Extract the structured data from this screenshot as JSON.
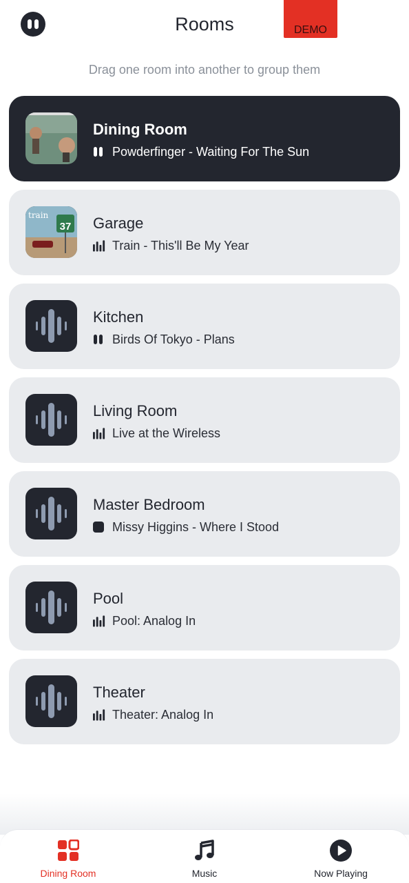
{
  "header": {
    "title": "Rooms",
    "demo_label": "DEMO"
  },
  "hint": "Drag one room into another to group them",
  "colors": {
    "accent": "#e33024",
    "dark": "#23262f",
    "card": "#e9ebee",
    "muted": "#8a9099"
  },
  "rooms": [
    {
      "name": "Dining Room",
      "status": "paused",
      "status_icon": "pause-icon",
      "now_playing": "Powderfinger - Waiting For The Sun",
      "art": "album-art"
    },
    {
      "name": "Garage",
      "status": "playing",
      "status_icon": "equalizer-icon",
      "now_playing": "Train - This'll Be My Year",
      "art": "album-art"
    },
    {
      "name": "Kitchen",
      "status": "paused",
      "status_icon": "pause-icon",
      "now_playing": "Birds Of Tokyo - Plans",
      "art": "speaker-icon"
    },
    {
      "name": "Living Room",
      "status": "playing",
      "status_icon": "equalizer-icon",
      "now_playing": "Live at the Wireless",
      "art": "speaker-icon"
    },
    {
      "name": "Master Bedroom",
      "status": "stopped",
      "status_icon": "stop-icon",
      "now_playing": "Missy Higgins - Where I Stood",
      "art": "speaker-icon"
    },
    {
      "name": "Pool",
      "status": "playing",
      "status_icon": "equalizer-icon",
      "now_playing": "Pool: Analog In",
      "art": "speaker-icon"
    },
    {
      "name": "Theater",
      "status": "playing",
      "status_icon": "equalizer-icon",
      "now_playing": "Theater: Analog In",
      "art": "speaker-icon"
    }
  ],
  "nav": {
    "items": [
      {
        "label": "Dining Room",
        "icon": "rooms-grid-icon",
        "active": true
      },
      {
        "label": "Music",
        "icon": "music-note-icon",
        "active": false
      },
      {
        "label": "Now Playing",
        "icon": "play-circle-icon",
        "active": false
      }
    ]
  }
}
